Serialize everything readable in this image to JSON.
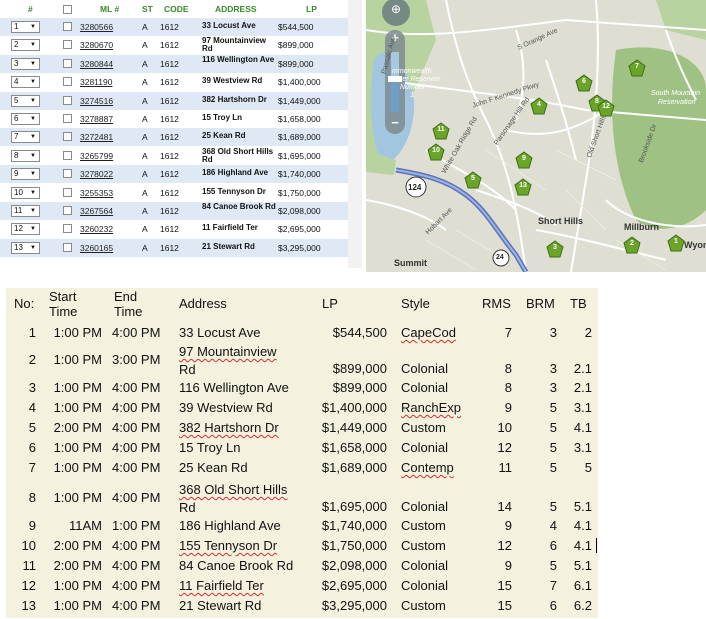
{
  "listing": {
    "headers": {
      "num": "#",
      "ml": "ML #",
      "st": "ST",
      "code": "CODE",
      "address": "ADDRESS",
      "lp": "LP"
    },
    "rows": [
      {
        "sel": "1",
        "ml": "3280566",
        "st": "A",
        "code": "1612",
        "addr": "33 Locust Ave",
        "lp": "$544,500"
      },
      {
        "sel": "2",
        "ml": "3280670",
        "st": "A",
        "code": "1612",
        "addr": "97 Mountainview Rd",
        "lp": "$899,000"
      },
      {
        "sel": "3",
        "ml": "3280844",
        "st": "A",
        "code": "1612",
        "addr": "116 Wellington Ave",
        "lp": "$899,000"
      },
      {
        "sel": "4",
        "ml": "3281190",
        "st": "A",
        "code": "1612",
        "addr": "39 Westview Rd",
        "lp": "$1,400,000"
      },
      {
        "sel": "5",
        "ml": "3274516",
        "st": "A",
        "code": "1612",
        "addr": "382 Hartshorn Dr",
        "lp": "$1,449,000"
      },
      {
        "sel": "6",
        "ml": "3278887",
        "st": "A",
        "code": "1612",
        "addr": "15 Troy Ln",
        "lp": "$1,658,000"
      },
      {
        "sel": "7",
        "ml": "3272481",
        "st": "A",
        "code": "1612",
        "addr": "25 Kean Rd",
        "lp": "$1,689,000"
      },
      {
        "sel": "8",
        "ml": "3265799",
        "st": "A",
        "code": "1612",
        "addr": "368 Old Short Hills Rd",
        "lp": "$1,695,000"
      },
      {
        "sel": "9",
        "ml": "3278022",
        "st": "A",
        "code": "1612",
        "addr": "186 Highland Ave",
        "lp": "$1,740,000"
      },
      {
        "sel": "10",
        "ml": "3255353",
        "st": "A",
        "code": "1612",
        "addr": "155 Tennyson Dr",
        "lp": "$1,750,000"
      },
      {
        "sel": "11",
        "ml": "3267564",
        "st": "A",
        "code": "1612",
        "addr": "84 Canoe Brook Rd",
        "lp": "$2,098,000"
      },
      {
        "sel": "12",
        "ml": "3260232",
        "st": "A",
        "code": "1612",
        "addr": "11 Fairfield Ter",
        "lp": "$2,695,000"
      },
      {
        "sel": "13",
        "ml": "3260165",
        "st": "A",
        "code": "1612",
        "addr": "21 Stewart Rd",
        "lp": "$3,295,000"
      }
    ]
  },
  "map": {
    "labels": {
      "reservoir1": "mmonwealth",
      "reservoir2": "Water Reservoir",
      "reservoir3": "Number",
      "reservoir4": "1",
      "south_mountain1": "South Mountain",
      "south_mountain2": "Reservation",
      "short_hills": "Short Hills",
      "millburn": "Millburn",
      "summit": "Summit",
      "wyoming": "Wyom",
      "orange_ave": "S Orange Ave",
      "jfk": "John F Kennedy Pkwy",
      "passaic": "Passaic Ave",
      "old_short_hills": "Old Short Hills Rd",
      "white_oak": "White Oak Ridge Rd",
      "parsonage": "Parsonage Hill Rd",
      "brookside": "Brookside Dr",
      "hobart": "Hobart Ave",
      "highway": "124",
      "highway2": "24"
    },
    "markers": [
      "1",
      "2",
      "3",
      "4",
      "5",
      "6",
      "7",
      "8",
      "9",
      "10",
      "11",
      "12",
      "13"
    ],
    "colors": {
      "marker": "#6aa52a",
      "park": "#a9c98d",
      "road": "#ffffff",
      "highway": "#6c86c9"
    }
  },
  "schedule": {
    "headers": {
      "no": "No:",
      "start1": "Start",
      "start2": "Time",
      "end1": "End",
      "end2": "Time",
      "address": "Address",
      "lp": "LP",
      "style": "Style",
      "rms": "RMS",
      "brm": "BRM",
      "tb": "TB"
    },
    "rows": [
      {
        "no": "1",
        "start": "1:00 PM",
        "end": "4:00 PM",
        "addr1": "33 Locust Ave",
        "addr2": "",
        "lp": "$544,500",
        "style": "CapeCod",
        "rms": "7",
        "brm": "3",
        "tb": "2"
      },
      {
        "no": "2",
        "start": "1:00 PM",
        "end": "3:00 PM",
        "addr1": "97 Mountainview",
        "addr2": "Rd",
        "lp": "$899,000",
        "style": "Colonial",
        "rms": "8",
        "brm": "3",
        "tb": "2.1"
      },
      {
        "no": "3",
        "start": "1:00 PM",
        "end": "4:00 PM",
        "addr1": "116 Wellington Ave",
        "addr2": "",
        "lp": "$899,000",
        "style": "Colonial",
        "rms": "8",
        "brm": "3",
        "tb": "2.1"
      },
      {
        "no": "4",
        "start": "1:00 PM",
        "end": "4:00 PM",
        "addr1": "39 Westview Rd",
        "addr2": "",
        "lp": "$1,400,000",
        "style": "RanchExp",
        "rms": "9",
        "brm": "5",
        "tb": "3.1"
      },
      {
        "no": "5",
        "start": "2:00 PM",
        "end": "4:00 PM",
        "addr1": "382 Hartshorn Dr",
        "addr2": "",
        "lp": "$1,449,000",
        "style": "Custom",
        "rms": "10",
        "brm": "5",
        "tb": "4.1"
      },
      {
        "no": "6",
        "start": "1:00 PM",
        "end": "4:00 PM",
        "addr1": "15 Troy Ln",
        "addr2": "",
        "lp": "$1,658,000",
        "style": "Colonial",
        "rms": "12",
        "brm": "5",
        "tb": "3.1"
      },
      {
        "no": "7",
        "start": "1:00 PM",
        "end": "4:00 PM",
        "addr1": "25 Kean Rd",
        "addr2": "",
        "lp": "$1,689,000",
        "style": "Contemp",
        "rms": "11",
        "brm": "5",
        "tb": "5"
      },
      {
        "no": "8",
        "start": "1:00 PM",
        "end": "4:00 PM",
        "addr1": "368 Old Short Hills",
        "addr2": "Rd",
        "lp": "$1,695,000",
        "style": "Colonial",
        "rms": "14",
        "brm": "5",
        "tb": "5.1"
      },
      {
        "no": "9",
        "start": "11AM",
        "end": "1:00 PM",
        "addr1": "186 Highland Ave",
        "addr2": "",
        "lp": "$1,740,000",
        "style": "Custom",
        "rms": "9",
        "brm": "4",
        "tb": "4.1"
      },
      {
        "no": "10",
        "start": "2:00 PM",
        "end": "4:00 PM",
        "addr1": "155 Tennyson Dr",
        "addr2": "",
        "lp": "$1,750,000",
        "style": "Custom",
        "rms": "12",
        "brm": "6",
        "tb": "4.1"
      },
      {
        "no": "11",
        "start": "2:00 PM",
        "end": "4:00 PM",
        "addr1": "84 Canoe Brook Rd",
        "addr2": "",
        "lp": "$2,098,000",
        "style": "Colonial",
        "rms": "9",
        "brm": "5",
        "tb": "5.1"
      },
      {
        "no": "12",
        "start": "1:00 PM",
        "end": "4:00 PM",
        "addr1": "11 Fairfield Ter",
        "addr2": "",
        "lp": "$2,695,000",
        "style": "Colonial",
        "rms": "15",
        "brm": "7",
        "tb": "6.1"
      },
      {
        "no": "13",
        "start": "1:00 PM",
        "end": "4:00 PM",
        "addr1": "21 Stewart Rd",
        "addr2": "",
        "lp": "$3,295,000",
        "style": "Custom",
        "rms": "15",
        "brm": "6",
        "tb": "6.2"
      }
    ]
  }
}
